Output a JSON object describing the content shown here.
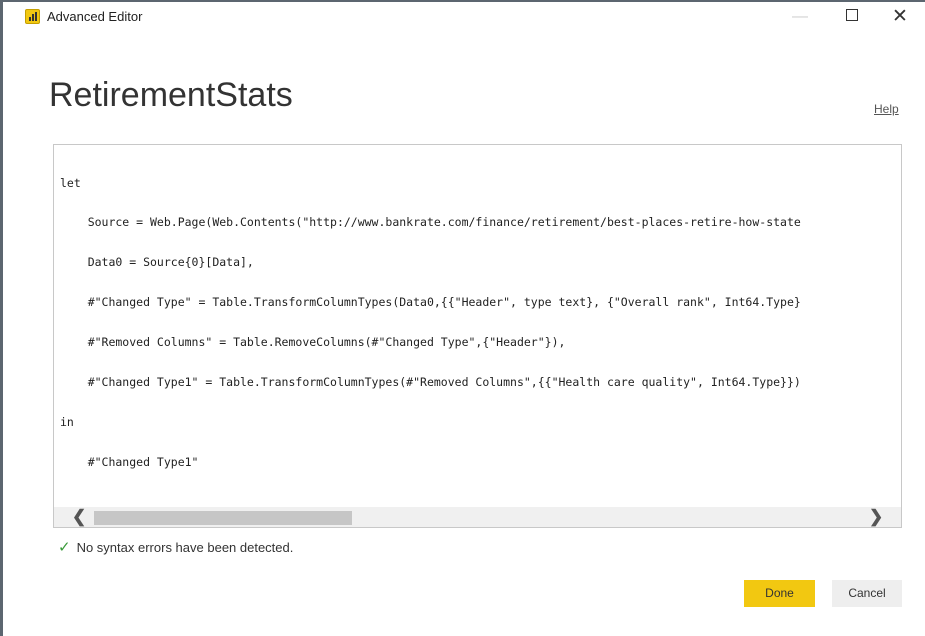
{
  "window": {
    "title": "Advanced Editor",
    "minimize_glyph": "—",
    "close_glyph": "✕",
    "app_icon": "power-bi-icon"
  },
  "query": {
    "name": "RetirementStats",
    "help_label": "Help"
  },
  "editor": {
    "lines": [
      "let",
      "    Source = Web.Page(Web.Contents(\"http://www.bankrate.com/finance/retirement/best-places-retire-how-state",
      "    Data0 = Source{0}[Data],",
      "    #\"Changed Type\" = Table.TransformColumnTypes(Data0,{{\"Header\", type text}, {\"Overall rank\", Int64.Type}",
      "    #\"Removed Columns\" = Table.RemoveColumns(#\"Changed Type\",{\"Header\"}),",
      "    #\"Changed Type1\" = Table.TransformColumnTypes(#\"Removed Columns\",{{\"Health care quality\", Int64.Type}})",
      "in",
      "    #\"Changed Type1\""
    ],
    "scroll_left_glyph": "❮",
    "scroll_right_glyph": "❯"
  },
  "status": {
    "icon": "checkmark-icon",
    "check_glyph": "✓",
    "message": "No syntax errors have been detected.",
    "color": "#3a9a3a"
  },
  "buttons": {
    "done_label": "Done",
    "cancel_label": "Cancel",
    "done_color": "#f2c811"
  }
}
